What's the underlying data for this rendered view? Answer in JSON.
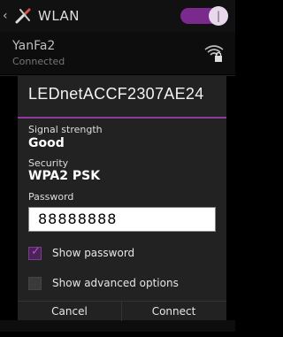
{
  "settings": {
    "title": "WLAN",
    "toggle_state": "on",
    "network": {
      "name": "YanFa2",
      "status": "Connected"
    }
  },
  "dialog": {
    "title": "LEDnetACCF2307AE24",
    "signal_label": "Signal strength",
    "signal_value": "Good",
    "security_label": "Security",
    "security_value": "WPA2 PSK",
    "password_label": "Password",
    "password_value": "88888888",
    "show_password_label": "Show password",
    "show_password_checked": true,
    "show_advanced_label": "Show advanced options",
    "show_advanced_checked": false,
    "cancel_label": "Cancel",
    "connect_label": "Connect"
  },
  "colors": {
    "accent": "#8e3a9e",
    "dialog_bg": "#222222"
  }
}
